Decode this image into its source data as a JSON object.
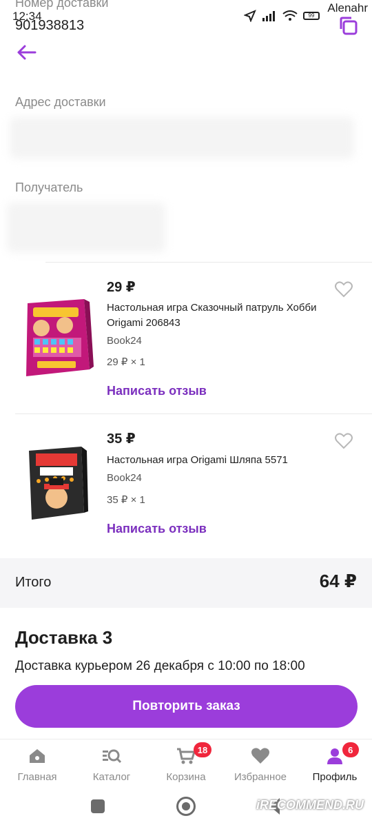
{
  "status_bar": {
    "time": "12:34",
    "user": "Alenahr",
    "battery": "99"
  },
  "header": {
    "delivery_number_label": "Номер доставки",
    "delivery_number": "901938813"
  },
  "address": {
    "label": "Адрес доставки"
  },
  "recipient": {
    "label": "Получатель"
  },
  "items": [
    {
      "price": "29 ₽",
      "title": "Настольная игра Сказочный патруль Хобби Origami 206843",
      "seller": "Book24",
      "qty": "29 ₽ × 1",
      "review": "Написать отзыв"
    },
    {
      "price": "35 ₽",
      "title": "Настольная игра Origami Шляпа 5571",
      "seller": "Book24",
      "qty": "35 ₽ × 1",
      "review": "Написать отзыв"
    }
  ],
  "total": {
    "label": "Итого",
    "value": "64 ₽"
  },
  "delivery": {
    "title": "Доставка 3",
    "info": "Доставка курьером 26 декабря с 10:00 по 18:00"
  },
  "repeat_button": "Повторить заказ",
  "nav": {
    "items": [
      {
        "label": "Главная",
        "icon": "home-icon"
      },
      {
        "label": "Каталог",
        "icon": "catalog-search-icon"
      },
      {
        "label": "Корзина",
        "icon": "cart-icon",
        "badge": "18"
      },
      {
        "label": "Избранное",
        "icon": "heart-icon"
      },
      {
        "label": "Профиль",
        "icon": "profile-icon",
        "badge": "6"
      }
    ]
  },
  "watermark": "iRECOMMEND.RU",
  "colors": {
    "accent": "#9b3ddb",
    "link": "#7b2fbe",
    "badge": "#f0263c",
    "total_bg": "#f5f5f7"
  }
}
